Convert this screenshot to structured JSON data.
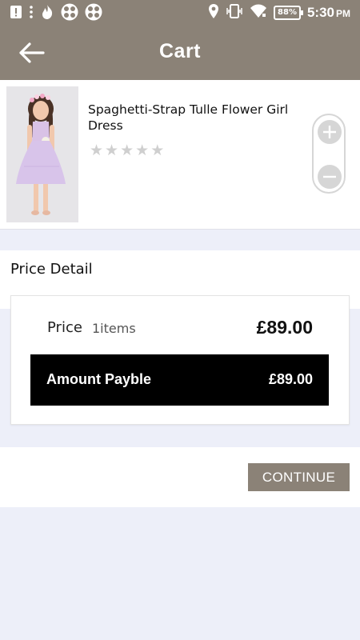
{
  "status_bar": {
    "time": "5:30",
    "ampm": "PM",
    "battery": "88%",
    "left_icons": [
      "alert-icon",
      "more-vert-icon",
      "flame-icon",
      "grid-app-icon",
      "grid-app-icon"
    ],
    "right_icons": [
      "location-icon",
      "vibrate-icon",
      "wifi-icon",
      "battery-icon"
    ]
  },
  "appbar": {
    "title": "Cart",
    "background": "#8b8277"
  },
  "cart_item": {
    "name": "Spaghetti-Strap Tulle Flower Girl Dress",
    "rating": 0,
    "max_rating": 5,
    "actions": [
      "plus-icon",
      "minus-icon"
    ]
  },
  "price_detail": {
    "title": "Price Detail",
    "price_label": "Price",
    "items_count": "1items",
    "price_value": "£89.00",
    "amount_label": "Amount Payble",
    "amount_value": "£89.00"
  },
  "footer": {
    "continue_label": "CONTINUE"
  },
  "colors": {
    "brand": "#8b8277",
    "page_bg": "#edeff9",
    "amount_bar": "#000000"
  }
}
